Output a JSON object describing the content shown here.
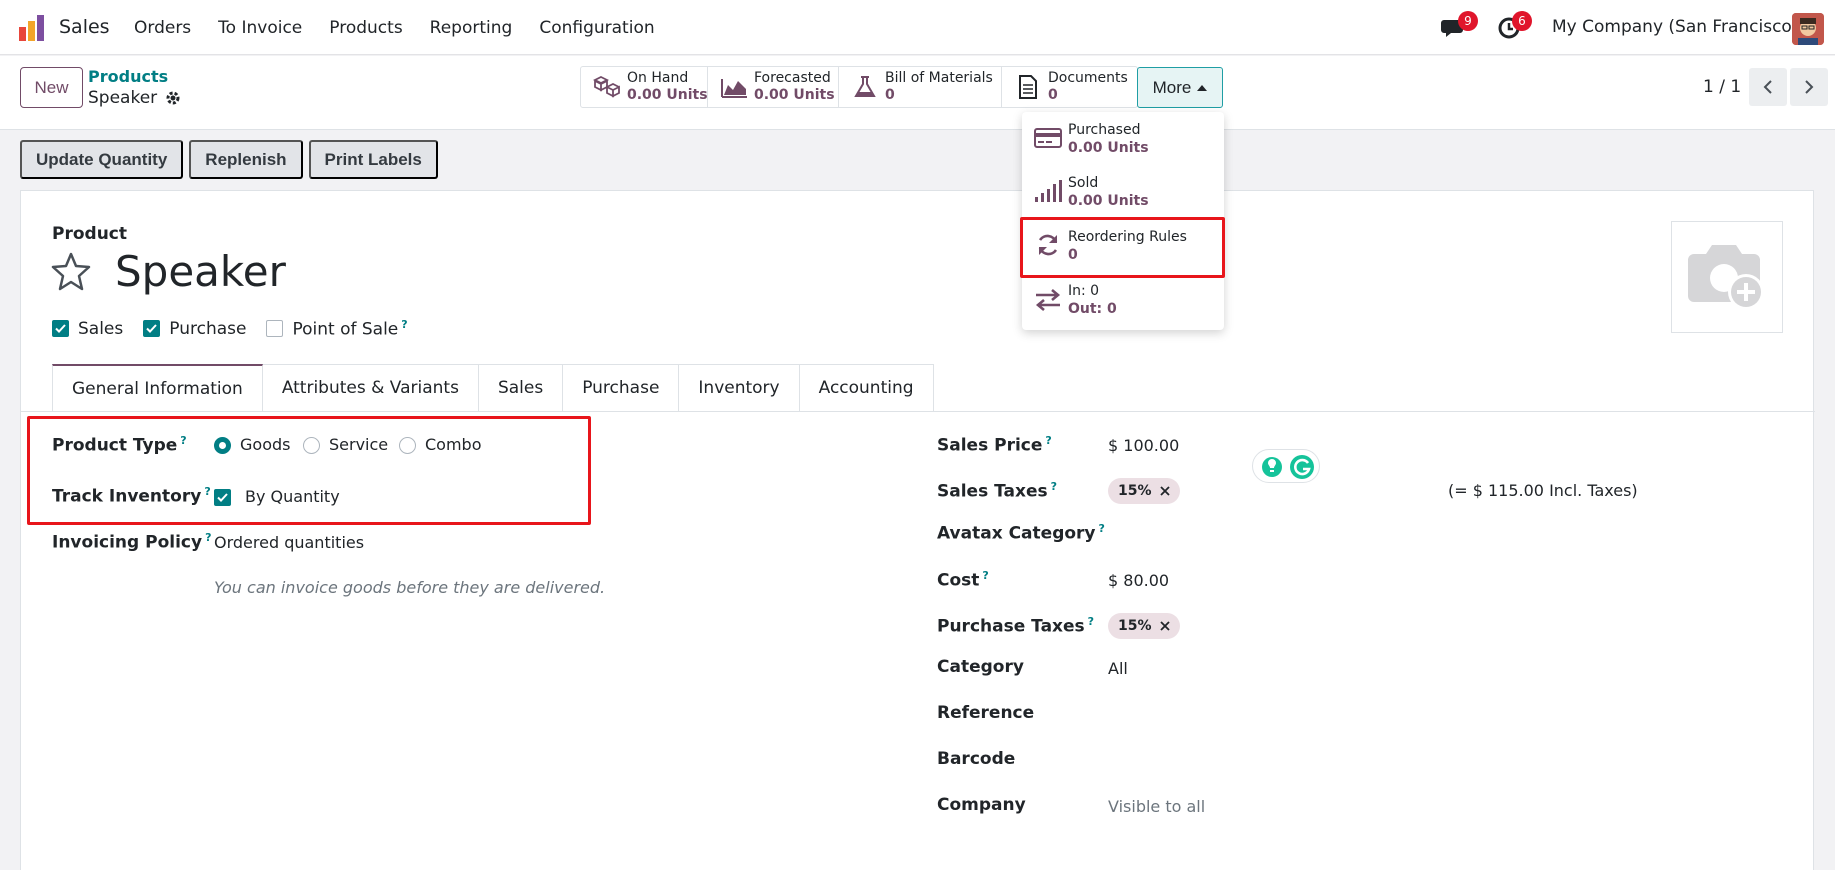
{
  "navbar": {
    "app_name": "Sales",
    "menu": [
      "Orders",
      "To Invoice",
      "Products",
      "Reporting",
      "Configuration"
    ],
    "messages_count": "9",
    "activities_count": "6",
    "company": "My Company (San Francisco)"
  },
  "control": {
    "new_label": "New",
    "breadcrumb_parent": "Products",
    "breadcrumb_current": "Speaker",
    "smart_buttons": [
      {
        "label": "On Hand",
        "value": "0.00 Units",
        "icon": "boxes-icon"
      },
      {
        "label": "Forecasted",
        "value": "0.00 Units",
        "icon": "area-chart-icon"
      },
      {
        "label": "Bill of Materials",
        "value": "0",
        "icon": "flask-icon"
      },
      {
        "label": "Documents",
        "value": "0",
        "icon": "document-icon"
      }
    ],
    "more_label": "More",
    "pager": "1 / 1"
  },
  "more_menu": [
    {
      "label": "Purchased",
      "value": "0.00 Units",
      "icon": "credit-card-icon"
    },
    {
      "label": "Sold",
      "value": "0.00 Units",
      "icon": "signal-bars-icon"
    },
    {
      "label": "Reordering Rules",
      "value": "0",
      "icon": "refresh-icon"
    },
    {
      "label": "In: 0",
      "value": "Out: 0",
      "icon": "exchange-icon"
    }
  ],
  "actions": [
    "Update Quantity",
    "Replenish",
    "Print Labels"
  ],
  "product": {
    "caption": "Product",
    "name": "Speaker",
    "flags": [
      {
        "label": "Sales",
        "checked": true
      },
      {
        "label": "Purchase",
        "checked": true
      },
      {
        "label": "Point of Sale",
        "checked": false
      }
    ],
    "tabs": [
      "General Information",
      "Attributes & Variants",
      "Sales",
      "Purchase",
      "Inventory",
      "Accounting"
    ],
    "active_tab": "General Information"
  },
  "general": {
    "product_type_label": "Product Type",
    "product_type_options": [
      "Goods",
      "Service",
      "Combo"
    ],
    "product_type_selected": "Goods",
    "track_inventory_label": "Track Inventory",
    "track_inventory_value": "By Quantity",
    "invoicing_policy_label": "Invoicing Policy",
    "invoicing_policy_value": "Ordered quantities",
    "invoicing_note": "You can invoice goods before they are delivered.",
    "sales_price_label": "Sales Price",
    "sales_price_value": "$ 100.00",
    "sales_taxes_label": "Sales Taxes",
    "sales_taxes_tag": "15%",
    "incl_taxes_note": "(= $ 115.00 Incl. Taxes)",
    "avatax_label": "Avatax Category",
    "cost_label": "Cost",
    "cost_value": "$ 80.00",
    "purchase_taxes_label": "Purchase Taxes",
    "purchase_taxes_tag": "15%",
    "category_label": "Category",
    "category_value": "All",
    "reference_label": "Reference",
    "barcode_label": "Barcode",
    "company_label": "Company",
    "company_value": "Visible to all"
  },
  "help_mark": "?",
  "colors": {
    "primary": "#714b67",
    "teal": "#017e84",
    "highlight": "#e8151b"
  }
}
